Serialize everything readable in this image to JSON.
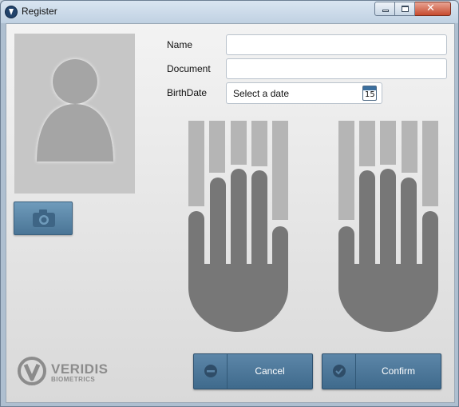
{
  "window": {
    "title": "Register",
    "icon": "veridis-app-icon"
  },
  "window_controls": {
    "minimize_icon": "minimize-icon",
    "maximize_icon": "maximize-icon",
    "close_icon": "close-icon",
    "close_glyph": "✕"
  },
  "photo": {
    "placeholder_icon": "person-silhouette-icon",
    "camera_button_icon": "camera-icon"
  },
  "form": {
    "name_label": "Name",
    "name_value": "",
    "document_label": "Document",
    "document_value": "",
    "birthdate_label": "BirthDate",
    "birthdate_placeholder": "Select a date",
    "calendar_day": "15"
  },
  "fingerprints": {
    "left_hand_icon": "left-hand-icon",
    "right_hand_icon": "right-hand-icon"
  },
  "brand": {
    "logo_line1": "VERIDIS",
    "logo_line2": "BIOMETRICS"
  },
  "actions": {
    "cancel_label": "Cancel",
    "confirm_label": "Confirm"
  },
  "colors": {
    "button_blue": "#4a7596",
    "hand_gray": "#777777",
    "finger_slot_gray": "#b5b5b5"
  }
}
